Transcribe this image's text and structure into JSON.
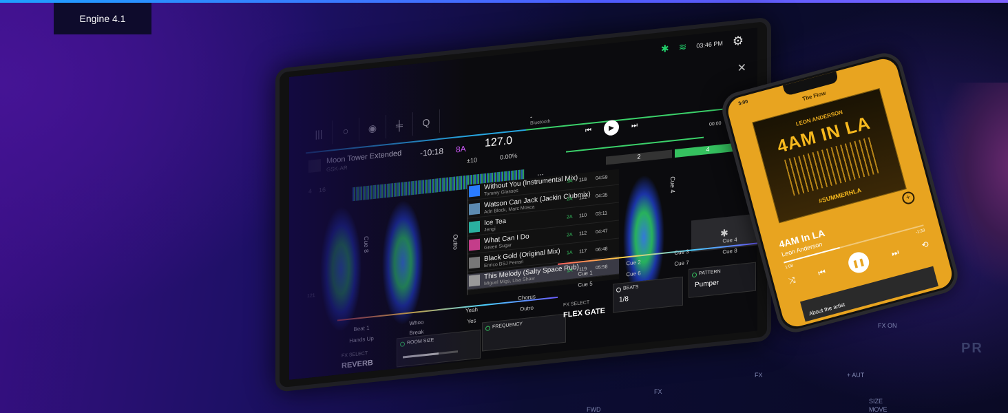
{
  "badge": "Engine 4.1",
  "status": {
    "time": "03:46 PM",
    "icons": [
      "bluetooth-icon",
      "wifi-icon",
      "gear-icon"
    ]
  },
  "toolbar_icons": [
    "library-icon",
    "search-icon",
    "record-icon",
    "split-icon",
    "quantize-icon"
  ],
  "deck1": {
    "title": "Moon Tower Extended",
    "artist": "GSK-AR",
    "remaining": "-10:18",
    "key": "8A",
    "bpm": "127.0",
    "pitch_range": "±10",
    "pitch_pct": "0.00%",
    "loop": "4",
    "beats": "16"
  },
  "bluetooth_source": {
    "title": "-",
    "source": "Bluetooth"
  },
  "transport": {
    "elapsed": "00:00"
  },
  "decks_right": {
    "deck2": "2",
    "deck4": "4"
  },
  "more": "...",
  "cues": {
    "cue8": "Cue 8",
    "cue4": "Cue 4",
    "outro": "Outro",
    "beat": "121"
  },
  "library": [
    {
      "title": "Without You (Instrumental Mix)",
      "artist": "Tommy Glasses",
      "key": "3A",
      "bpm": "118",
      "dur": "04:59"
    },
    {
      "title": "Watson Can Jack (Jackin Clubmix)",
      "artist": "Adri Block, Marc Mosca",
      "key": "2A",
      "bpm": "122",
      "dur": "04:35"
    },
    {
      "title": "Ice Tea",
      "artist": "Jengi",
      "key": "2A",
      "bpm": "110",
      "dur": "03:11"
    },
    {
      "title": "What Can I Do",
      "artist": "Green Sugar",
      "key": "2A",
      "bpm": "112",
      "dur": "04:47"
    },
    {
      "title": "Black Gold (Original Mix)",
      "artist": "Enrico BSJ Ferrari",
      "key": "1A",
      "bpm": "117",
      "dur": "06:48"
    },
    {
      "title": "This Melody (Salty Space Rub)",
      "artist": "Miguel Migs, Lisa Shaw",
      "key": "1A",
      "bpm": "119",
      "dur": "05:58"
    }
  ],
  "pads_left": {
    "beat1": "Beat 1",
    "whoo": "Whoo",
    "yeah": "Yeah",
    "chorus": "Chorus",
    "hands_up": "Hands Up",
    "break": "Break",
    "yes": "Yes",
    "outro": "Outro"
  },
  "pads_right": {
    "cue1": "Cue 1",
    "cue2": "Cue 2",
    "cue3": "Cue 3",
    "cue4": "Cue 4",
    "cue5": "Cue 5",
    "cue6": "Cue 6",
    "cue7": "Cue 7",
    "cue8": "Cue 8"
  },
  "fx_left": {
    "select_label": "FX SELECT",
    "value": "REVERB",
    "param1": "ROOM SIZE",
    "param2": "FREQUENCY",
    "room_size_level": 0.65
  },
  "fx_right": {
    "select_label": "FX SELECT",
    "value": "FLEX GATE",
    "param1": "BEATS",
    "param1_value": "1/8",
    "param2": "PATTERN",
    "param2_value": "Pumper"
  },
  "phone": {
    "time": "3:00",
    "header": "The Flow",
    "cover_artist": "LEON ANDERSON",
    "cover_title": "4AM IN LA",
    "cover_hash": "#SUMMERHLA",
    "title": "4AM In LA",
    "artist": "Leon Anderson",
    "elapsed": "1:08",
    "remaining": "-1:33",
    "progress": 0.4,
    "about": "About the artist"
  },
  "console": {
    "fx": "FX",
    "fwd": "FWD",
    "size": "SIZE",
    "move": "MOVE",
    "auto": "+ AUT",
    "fx_on": "FX ON",
    "brand": "PR"
  }
}
